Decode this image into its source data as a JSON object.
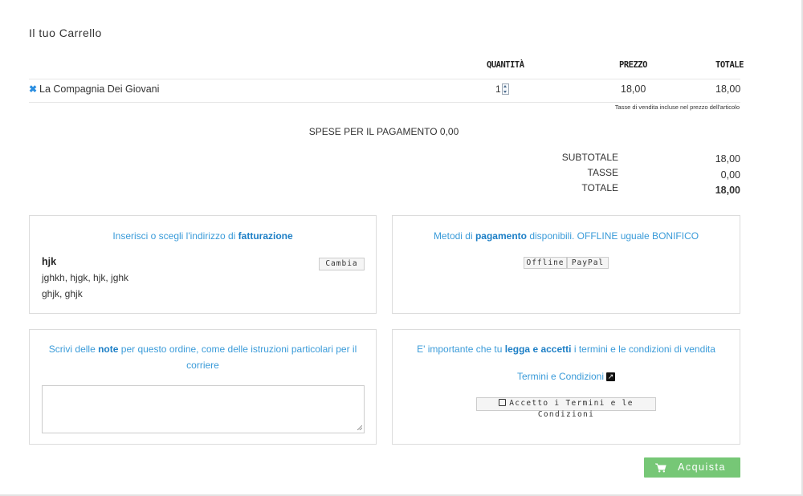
{
  "page": {
    "title": "Il tuo Carrello"
  },
  "table": {
    "headers": {
      "quantity": "QUANTITÀ",
      "price": "PREZZO",
      "total": "TOTALE"
    },
    "rows": [
      {
        "product": "La Compagnia Dei Giovani",
        "quantity": "1",
        "price": "18,00",
        "total": "18,00"
      }
    ],
    "tax_note": "Tasse di vendita incluse nel prezzo dell'articolo"
  },
  "payment_fee": {
    "label": "SPESE PER IL PAGAMENTO",
    "value": "0,00"
  },
  "summary": {
    "subtotal_label": "SUBTOTALE",
    "subtotal": "18,00",
    "tax_label": "TASSE",
    "tax": "0,00",
    "total_label": "TOTALE",
    "total": "18,00"
  },
  "billing": {
    "title_pre": "Inserisci o scegli l'indirizzo di ",
    "title_bold": "fatturazione",
    "change_button": "Cambia",
    "name": "hjk",
    "line1": "jghkh, hjgk, hjk, jghk",
    "line2": "ghjk, ghjk"
  },
  "payment": {
    "title_pre": "Metodi di ",
    "title_bold": "pagamento",
    "title_post": " disponibili. OFFLINE uguale BONIFICO",
    "options": [
      "Offline",
      "PayPal"
    ]
  },
  "notes": {
    "title_pre": "Scrivi delle ",
    "title_bold": "note",
    "title_post_1": " per questo ordine, come delle istruzioni particolari per il",
    "title_post_2": "corriere",
    "value": ""
  },
  "terms": {
    "title_pre": "E' importante che tu ",
    "title_bold": "legga e accetti",
    "title_post": " i termini e le condizioni di vendita",
    "link": "Termini e Condizioni",
    "accept_label": "Accetto i Termini e le Condizioni"
  },
  "buy_button": {
    "label": "Acquista"
  },
  "colors": {
    "accent": "#3a9bd9",
    "buy": "#76c776",
    "remove": "#2b8ee0"
  }
}
